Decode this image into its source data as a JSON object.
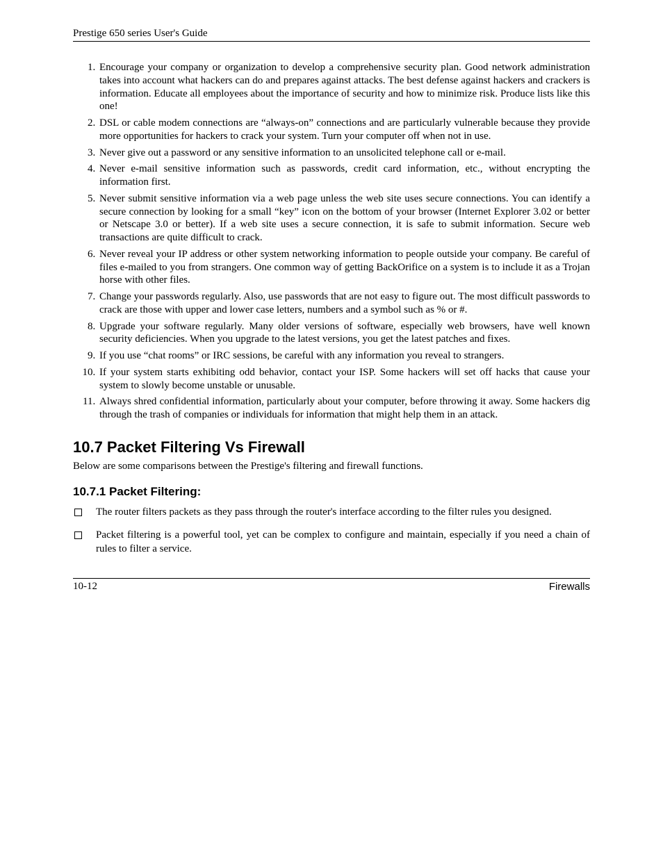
{
  "header": "Prestige 650 series User's Guide",
  "list": [
    "Encourage your company or organization to develop a comprehensive security plan. Good network administration takes into account what hackers can do and prepares against attacks. The best defense against hackers and crackers is information. Educate all employees about the importance of security and how to minimize risk. Produce lists like this one!",
    "DSL or cable modem connections are “always-on” connections and are particularly vulnerable because they provide more opportunities for hackers to crack your system. Turn your computer off when not in use.",
    "Never give out a password or any sensitive information to an unsolicited telephone call or e-mail.",
    "Never e-mail sensitive information such as passwords, credit card information, etc., without encrypting the information first.",
    "Never submit sensitive information via a web page unless the web site uses secure connections. You can identify a secure connection by looking for a small “key” icon on the bottom of your browser (Internet Explorer 3.02 or better or Netscape 3.0 or better). If a web site uses a secure connection, it is safe to submit information. Secure web transactions are quite difficult to crack.",
    "Never reveal your IP address or other system networking information to people outside your company. Be careful of files e-mailed to you from strangers. One common way of getting BackOrifice on a system is to include it as a Trojan horse with other files.",
    "Change your passwords regularly. Also, use passwords that are not easy to figure out. The most difficult passwords to crack are those with upper and lower case letters, numbers and a symbol such as % or #.",
    "Upgrade your software regularly. Many older versions of software, especially web browsers, have well known security deficiencies. When you upgrade to the latest versions, you get the latest patches and fixes.",
    "If you use “chat rooms” or IRC sessions, be careful with any information you reveal to strangers.",
    "If your system starts exhibiting odd behavior, contact your ISP. Some hackers will set off hacks that cause your system to slowly become unstable or unusable.",
    "Always shred confidential information, particularly about your computer, before throwing it away. Some hackers dig through the trash of companies or individuals for information that might help them in an attack."
  ],
  "section_heading": "10.7  Packet Filtering Vs Firewall",
  "section_intro": "Below are some comparisons between the Prestige's filtering and firewall functions.",
  "subsection_heading": "10.7.1 Packet Filtering:",
  "bullets": [
    "The router filters packets as they pass through the router's interface according to the filter rules you designed.",
    "Packet filtering is a powerful tool, yet can be complex to configure and maintain, especially if you need a chain of rules to filter a service."
  ],
  "footer_left": "10-12",
  "footer_right": "Firewalls"
}
